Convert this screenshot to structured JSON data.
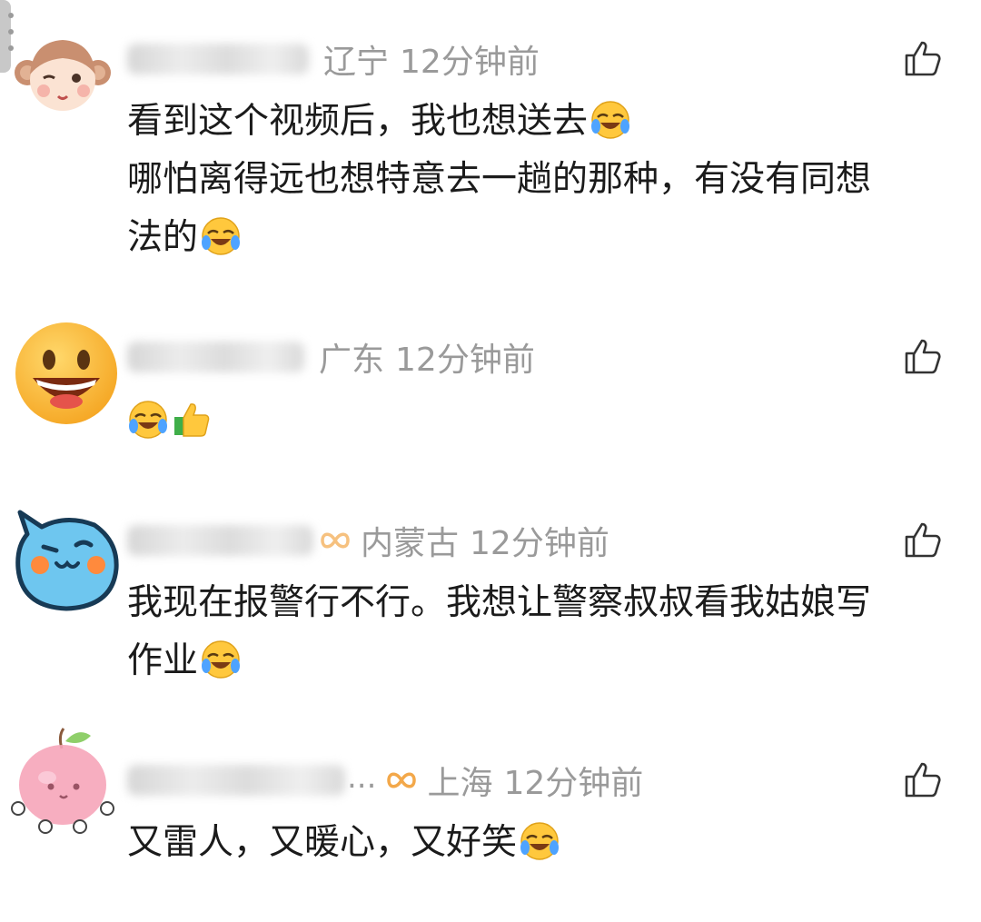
{
  "icons": {
    "like": "thumbs-up-outline-icon",
    "laugh": "laugh-cry-emoji-icon",
    "thumbs": "thumbs-up-emoji-icon",
    "badge": "infinity-badge-icon"
  },
  "colors": {
    "meta_text": "#9a9a9a",
    "body_text": "#1b1b1b",
    "badge": "#f3a84a"
  },
  "comments": [
    {
      "location": "辽宁",
      "time": "12分钟前",
      "lines": [
        "看到这个视频后，我也想送去",
        "哪怕离得远也想特意去一趟的那种，有没有同想",
        "法的"
      ]
    },
    {
      "location": "广东",
      "time": "12分钟前",
      "lines": [
        ""
      ]
    },
    {
      "location": "内蒙古",
      "time": "12分钟前",
      "lines": [
        "我现在报警行不行。我想让警察叔叔看我姑娘写",
        "作业"
      ]
    },
    {
      "location": "上海",
      "time": "12分钟前",
      "ellipsis": "...",
      "lines": [
        "又雷人，又暖心，又好笑"
      ]
    }
  ]
}
